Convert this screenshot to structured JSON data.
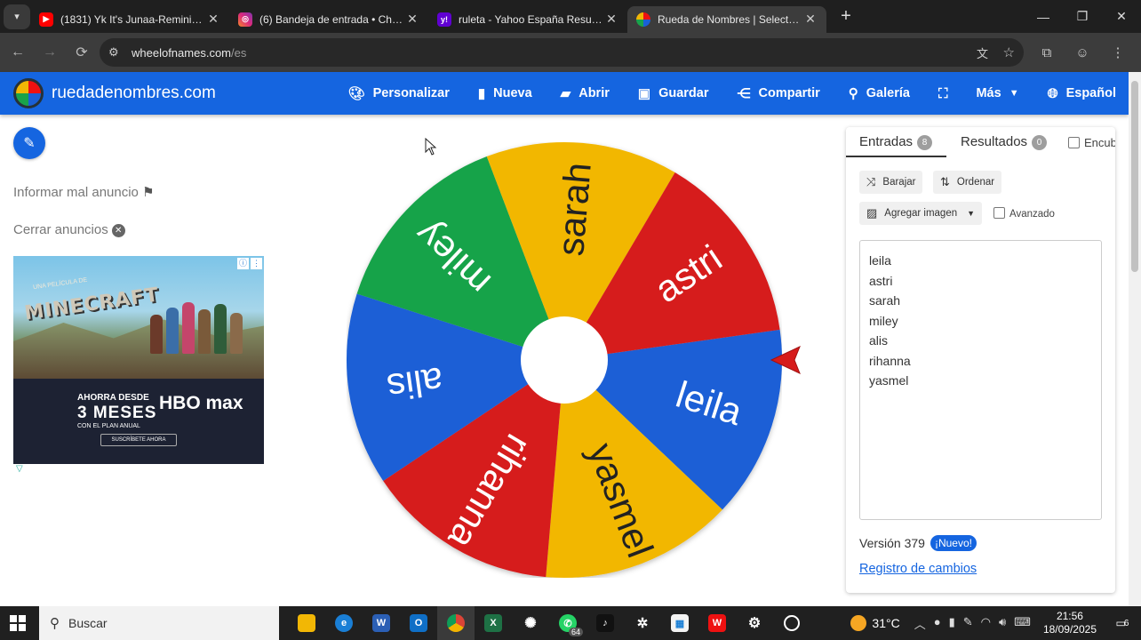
{
  "browser": {
    "tabs": [
      {
        "title": "(1831) Yk It's Junaa-Reminiscin...",
        "favicon": "youtube-icon",
        "color": "#ff0000",
        "active": false
      },
      {
        "title": "(6) Bandeja de entrada • Chats",
        "favicon": "instagram-icon",
        "color": "#d6249f",
        "active": false
      },
      {
        "title": "ruleta - Yahoo España Resultad...",
        "favicon": "yahoo-icon",
        "color": "#6001d2",
        "active": false
      },
      {
        "title": "Rueda de Nombres | Selector de...",
        "favicon": "wheel-icon",
        "color": "#1565e0",
        "active": true
      }
    ],
    "url_host": "wheelofnames.com",
    "url_path": "/es"
  },
  "site": {
    "brand": "ruedadenombres.com",
    "menu": [
      {
        "label": "Personalizar",
        "icon": "palette-icon"
      },
      {
        "label": "Nueva",
        "icon": "file-icon"
      },
      {
        "label": "Abrir",
        "icon": "folder-icon"
      },
      {
        "label": "Guardar",
        "icon": "save-icon"
      },
      {
        "label": "Compartir",
        "icon": "share-icon"
      },
      {
        "label": "Galería",
        "icon": "search-icon"
      },
      {
        "label": "",
        "icon": "fullscreen-icon"
      },
      {
        "label": "Más",
        "icon": "chevron-down-icon"
      },
      {
        "label": "Español",
        "icon": "globe-icon"
      }
    ]
  },
  "sidebar": {
    "report_ad": "Informar mal anuncio",
    "close_ads": "Cerrar anuncios"
  },
  "ad": {
    "movie_subtitle": "UNA PELÍCULA DE",
    "movie_title": "MINECRAFT",
    "line1": "AHORRA DESDE",
    "line2": "3 MESES",
    "line3": "CON EL PLAN ANUAL",
    "brand": "HBO max",
    "cta": "SUSCRÍBETE AHORA"
  },
  "wheel": {
    "segments": [
      {
        "name": "leila",
        "color": "#1a5fd6"
      },
      {
        "name": "yasmel",
        "color": "#f2b705"
      },
      {
        "name": "rihanna",
        "color": "#d61b1b"
      },
      {
        "name": "alis",
        "color": "#1a5fd6"
      },
      {
        "name": "miley",
        "color": "#19a34a"
      },
      {
        "name": "sarah",
        "color": "#f2b705"
      },
      {
        "name": "astri",
        "color": "#d61b1b"
      }
    ]
  },
  "panel": {
    "tab_entries": "Entradas",
    "tab_entries_count": "8",
    "tab_results": "Resultados",
    "tab_results_count": "0",
    "hide_label": "Encubrir",
    "shuffle": "Barajar",
    "sort": "Ordenar",
    "add_image": "Agregar imagen",
    "advanced": "Avanzado",
    "entries": [
      "leila",
      "astri",
      "sarah",
      "miley",
      "alis",
      "rihanna",
      "yasmel"
    ],
    "version": "Versión 379",
    "new_badge": "¡Nuevo!",
    "changelog": "Registro de cambios"
  },
  "taskbar": {
    "search_placeholder": "Buscar",
    "temperature": "31°C",
    "time": "21:56",
    "date": "18/09/2025",
    "whatsapp_badge": "64",
    "notifications": "6"
  }
}
